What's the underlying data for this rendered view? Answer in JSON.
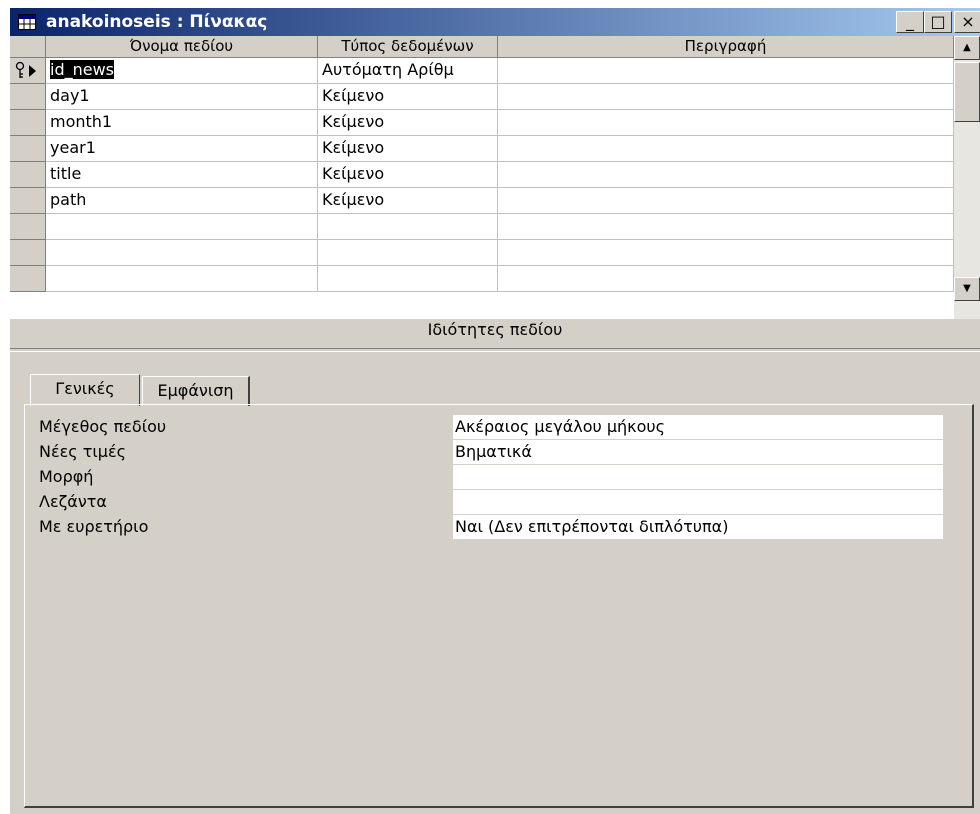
{
  "window": {
    "title": "anakoinoseis : Πίνακας",
    "controls": {
      "minimize": "_",
      "maximize": "□",
      "close": "×"
    }
  },
  "grid": {
    "headers": [
      "Όνομα πεδίου",
      "Τύπος δεδομένων",
      "Περιγραφή"
    ],
    "rows": [
      {
        "name": "id_news",
        "type": "Αυτόματη Αρίθμ",
        "description": "",
        "primary_key": true,
        "current": true
      },
      {
        "name": "day1",
        "type": "Κείμενο",
        "description": ""
      },
      {
        "name": "month1",
        "type": "Κείμενο",
        "description": ""
      },
      {
        "name": "year1",
        "type": "Κείμενο",
        "description": ""
      },
      {
        "name": "title",
        "type": "Κείμενο",
        "description": ""
      },
      {
        "name": "path",
        "type": "Κείμενο",
        "description": ""
      },
      {
        "name": "",
        "type": "",
        "description": ""
      },
      {
        "name": "",
        "type": "",
        "description": ""
      },
      {
        "name": "",
        "type": "",
        "description": ""
      }
    ]
  },
  "properties": {
    "label": "Ιδιότητες πεδίου",
    "tabs": [
      {
        "label": "Γενικές",
        "active": true
      },
      {
        "label": "Εμφάνιση",
        "active": false
      }
    ],
    "items": [
      {
        "label": "Μέγεθος πεδίου",
        "value": "Ακέραιος μεγάλου μήκους"
      },
      {
        "label": "Νέες τιμές",
        "value": "Βηματικά"
      },
      {
        "label": "Μορφή",
        "value": ""
      },
      {
        "label": "Λεζάντα",
        "value": ""
      },
      {
        "label": "Με ευρετήριο",
        "value": "Ναι (Δεν επιτρέπονται διπλότυπα)"
      }
    ]
  },
  "colors": {
    "title_bar_start": "#0a246a",
    "title_bar_end": "#a6caf0",
    "face": "#d4d0c8",
    "selection": "#000000"
  }
}
